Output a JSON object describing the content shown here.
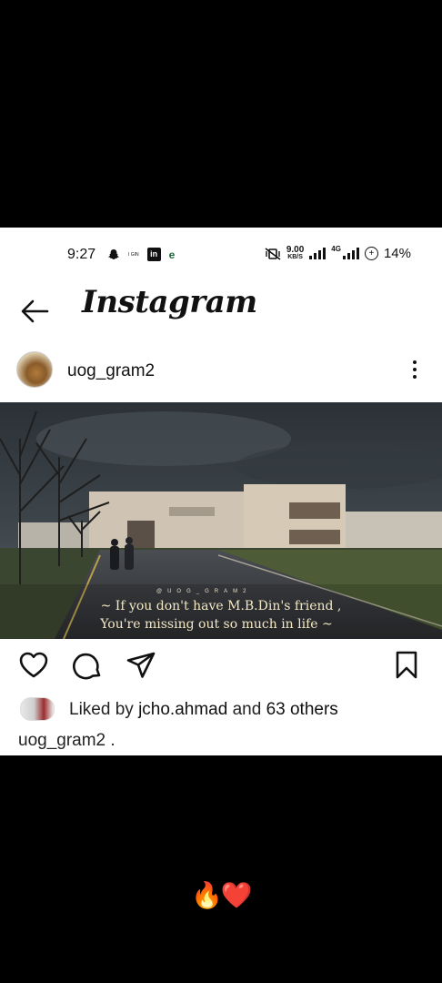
{
  "status_bar": {
    "time": "9:27",
    "tiny_label": "I GIN",
    "net_speed_value": "9.00",
    "net_speed_unit": "KB/S",
    "network_type": "4G",
    "battery": "14%"
  },
  "header": {
    "title": "Instagram"
  },
  "post": {
    "username": "uog_gram2",
    "overlay": {
      "brand": "@UOG_GRAM2",
      "line1": "~ If you don't have M.B.Din's friend ,",
      "line2": "You're missing out so much in life ~"
    },
    "liked_by_prefix": "Liked by",
    "liked_by_user": "jcho.ahmad",
    "liked_by_middle": "and",
    "liked_by_others": "63 others",
    "caption": "uog_gram2 ."
  },
  "reaction_emojis": "🔥❤️",
  "colors": {
    "text": "#111111",
    "background": "#ffffff",
    "overlay_text": "#f2e8c4"
  }
}
